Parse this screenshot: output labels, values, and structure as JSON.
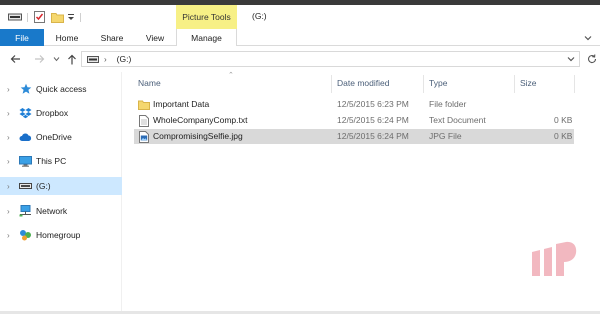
{
  "quick_access_toolbar": {
    "icons": [
      "drive-icon",
      "properties-check-icon",
      "new-folder-icon",
      "customize-dropdown-icon"
    ]
  },
  "ribbon": {
    "context_group": "Picture Tools",
    "window_title": "(G:)",
    "tabs": [
      {
        "label": "File",
        "active": true
      },
      {
        "label": "Home"
      },
      {
        "label": "Share"
      },
      {
        "label": "View"
      },
      {
        "label": "Manage"
      }
    ]
  },
  "navigation": {
    "address_segment": "(G:)"
  },
  "sidebar": {
    "items": [
      {
        "label": "Quick access",
        "icon": "star-icon"
      },
      {
        "label": "Dropbox",
        "icon": "dropbox-icon"
      },
      {
        "label": "OneDrive",
        "icon": "cloud-icon"
      },
      {
        "label": "This PC",
        "icon": "computer-icon"
      },
      {
        "label": "(G:)",
        "icon": "drive-icon",
        "selected": true
      },
      {
        "label": "Network",
        "icon": "network-icon"
      },
      {
        "label": "Homegroup",
        "icon": "homegroup-icon"
      }
    ]
  },
  "file_list": {
    "columns": {
      "name": "Name",
      "date_modified": "Date modified",
      "type": "Type",
      "size": "Size"
    },
    "rows": [
      {
        "name": "Important Data",
        "date": "12/5/2015 6:23 PM",
        "type": "File folder",
        "size": "",
        "icon": "folder-icon"
      },
      {
        "name": "WholeCompanyComp.txt",
        "date": "12/5/2015 6:24 PM",
        "type": "Text Document",
        "size": "0 KB",
        "icon": "text-file-icon"
      },
      {
        "name": "CompromisingSelfie.jpg",
        "date": "12/5/2015 6:24 PM",
        "type": "JPG File",
        "size": "0 KB",
        "icon": "image-file-icon",
        "selected": true
      }
    ]
  },
  "colors": {
    "file_tab": "#1979ca",
    "context_tab": "#f7f086",
    "sidebar_selected": "#cde8ff",
    "row_selected": "#d9d9d9",
    "header_text": "#4c607a",
    "watermark": "#f2b8c0"
  }
}
